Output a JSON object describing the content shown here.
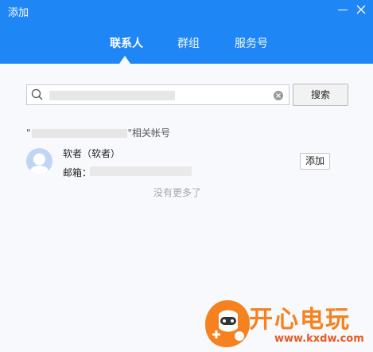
{
  "window": {
    "title": "添加",
    "colors": {
      "header": "#1f86f5",
      "background": "#f7f9fc",
      "watermark": "#f5821f"
    }
  },
  "tabs": [
    {
      "label": "联系人",
      "selected": true
    },
    {
      "label": "群组",
      "selected": false
    },
    {
      "label": "服务号",
      "selected": false
    }
  ],
  "search": {
    "value": "",
    "button_label": "搜索",
    "icon": "search-icon"
  },
  "results": {
    "quote_open": "\"",
    "label_suffix": "\"相关帐号",
    "items": [
      {
        "name": "软者（软者）",
        "email_label": "邮箱：",
        "add_label": "添加"
      }
    ],
    "empty_text": "没有更多了"
  },
  "watermark": {
    "brand": "开心电玩",
    "url": "www.kxdw.com"
  }
}
